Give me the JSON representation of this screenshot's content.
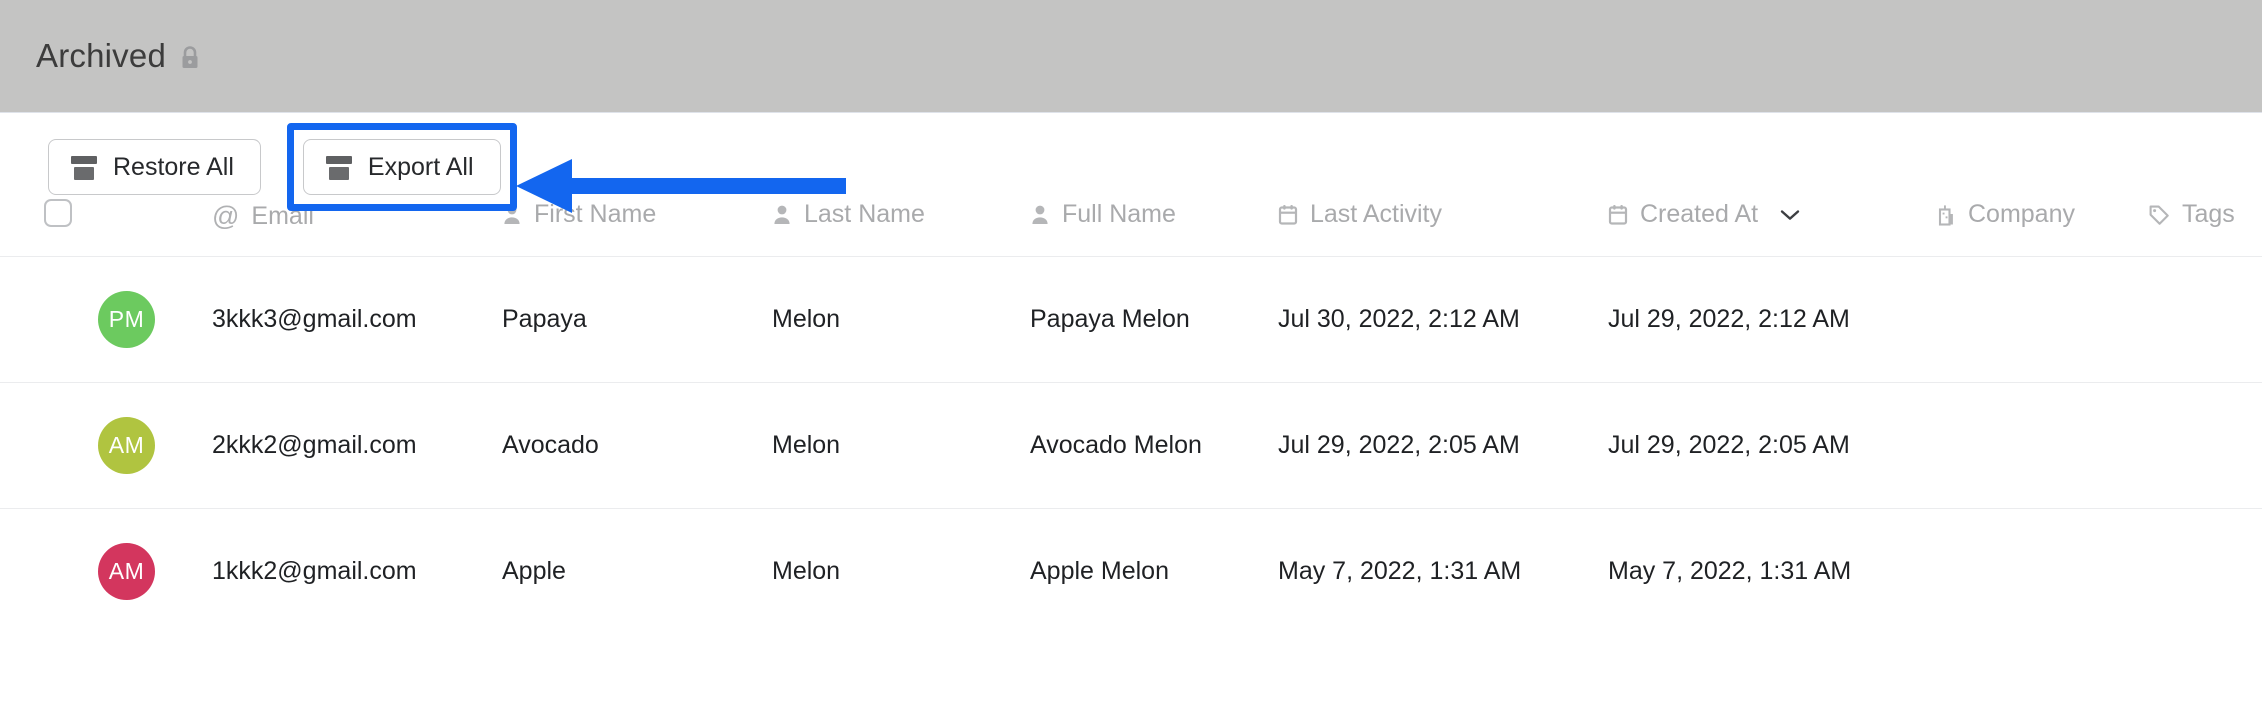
{
  "header": {
    "title": "Archived",
    "lock_icon": "lock-icon"
  },
  "toolbar": {
    "restore_all_label": "Restore All",
    "export_all_label": "Export All",
    "icon": "archive-box-icon"
  },
  "annotation": {
    "color": "#1366ef",
    "highlight_target": "Export All",
    "arrow_direction": "left"
  },
  "table": {
    "select_all_checkbox": "unchecked",
    "columns": [
      {
        "label": "",
        "icon": "checkbox-icon"
      },
      {
        "label": "Email",
        "icon": "at-icon"
      },
      {
        "label": "First Name",
        "icon": "person-icon"
      },
      {
        "label": "Last Name",
        "icon": "person-icon"
      },
      {
        "label": "Full Name",
        "icon": "person-icon"
      },
      {
        "label": "Last Activity",
        "icon": "calendar-icon"
      },
      {
        "label": "Created At",
        "icon": "calendar-icon",
        "sort_icon": "chevron-down-icon"
      },
      {
        "label": "Company",
        "icon": "building-icon"
      },
      {
        "label": "Tags",
        "icon": "tag-icon"
      }
    ],
    "rows": [
      {
        "avatar_initials": "PM",
        "avatar_color": "#6cca5f",
        "email": "3kkk3@gmail.com",
        "first_name": "Papaya",
        "last_name": "Melon",
        "full_name": "Papaya Melon",
        "last_activity": "Jul 30, 2022, 2:12 AM",
        "created_at": "Jul 29, 2022, 2:12 AM",
        "company": "",
        "tags": ""
      },
      {
        "avatar_initials": "AM",
        "avatar_color": "#b0c440",
        "email": "2kkk2@gmail.com",
        "first_name": "Avocado",
        "last_name": "Melon",
        "full_name": "Avocado Melon",
        "last_activity": "Jul 29, 2022, 2:05 AM",
        "created_at": "Jul 29, 2022, 2:05 AM",
        "company": "",
        "tags": ""
      },
      {
        "avatar_initials": "AM",
        "avatar_color": "#d3365e",
        "email": "1kkk2@gmail.com",
        "first_name": "Apple",
        "last_name": "Melon",
        "full_name": "Apple Melon",
        "last_activity": "May 7, 2022, 1:31 AM",
        "created_at": "May 7, 2022, 1:31 AM",
        "company": "",
        "tags": ""
      }
    ]
  }
}
